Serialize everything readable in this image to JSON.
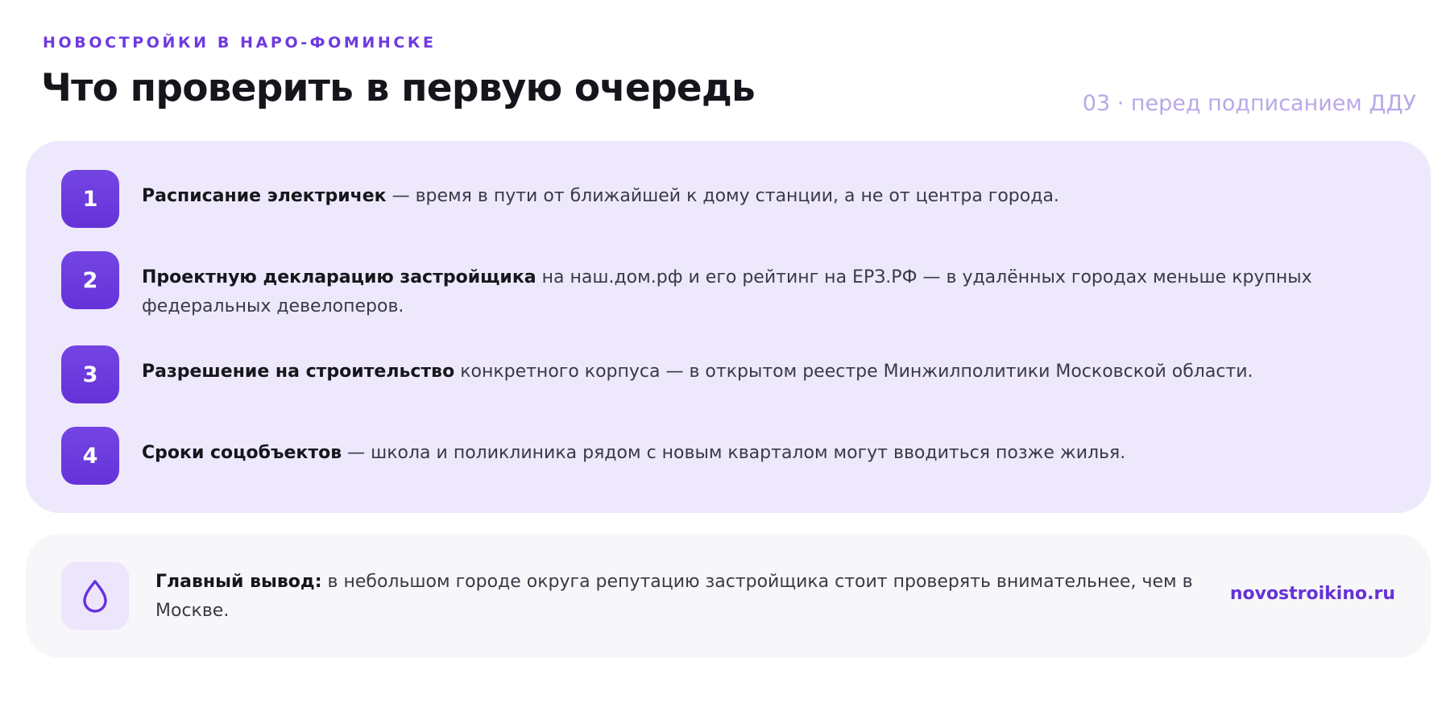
{
  "header": {
    "kicker": "НОВОСТРОЙКИ В НАРО-ФОМИНСКЕ",
    "title": "Что проверить в первую очередь",
    "tagline": "03 · перед подписанием ДДУ"
  },
  "checklist": {
    "items": [
      {
        "number": "1",
        "bold": "Расписание электричек",
        "text": " — время в пути от ближайшей к дому станции, а не от центра города."
      },
      {
        "number": "2",
        "bold": "Проектную декларацию застройщика",
        "text": " на наш.дом.рф и его рейтинг на ЕРЗ.РФ — в удалённых городах меньше крупных федеральных девелоперов."
      },
      {
        "number": "3",
        "bold": "Разрешение на строительство",
        "text": " конкретного корпуса — в открытом реестре Минжилполитики Московской области."
      },
      {
        "number": "4",
        "bold": "Сроки соцобъектов",
        "text": " — школа и поликлиника рядом с новым кварталом могут вводиться позже жилья."
      }
    ]
  },
  "summary": {
    "icon": "drop-icon",
    "bold": "Главный вывод:",
    "text": " в небольшом городе округа репутацию застройщика стоит проверять внимательнее, чем в Москве.",
    "link_label": "novostroikino.ru"
  },
  "colors": {
    "accent": "#6532d8",
    "card_background": "#eee8fc",
    "summary_background": "#f7f6f9",
    "tagline": "#b9a8e8"
  }
}
